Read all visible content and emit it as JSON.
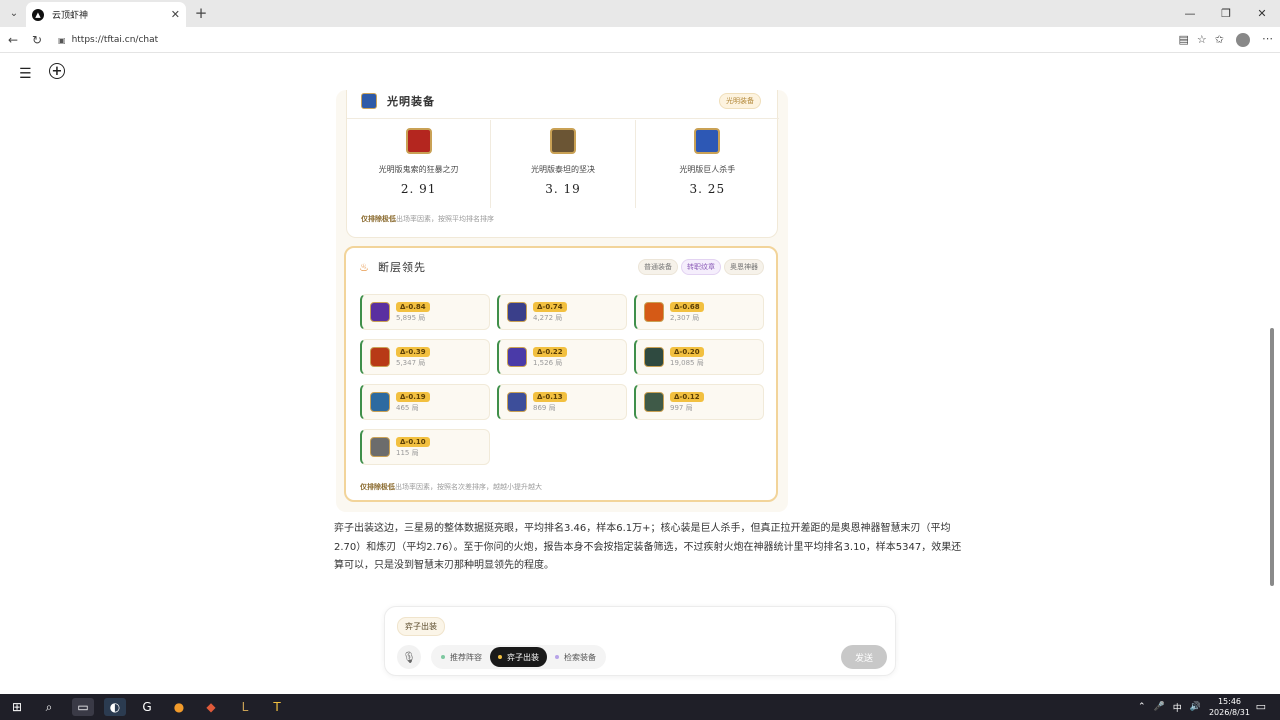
{
  "browser": {
    "tab_title": "云顶虾神",
    "url": "https://tftai.cn/chat",
    "window_controls": [
      "—",
      "❐",
      "✕"
    ]
  },
  "equipment_section": {
    "title": "光明装备",
    "badge": "光明装备",
    "items": [
      {
        "name": "光明版鬼索的狂暴之刃",
        "value": "2. 91",
        "color": "#b4261f"
      },
      {
        "name": "光明版泰坦的坚决",
        "value": "3. 19",
        "color": "#6b5534"
      },
      {
        "name": "光明版巨人杀手",
        "value": "3. 25",
        "color": "#2d58b5"
      }
    ],
    "note_strong": "仅排除极低",
    "note_rest": "出场率因素，按照平均排名排序"
  },
  "breakpoint_section": {
    "title": "断层领先",
    "pills": [
      "普通装备",
      "转职纹章",
      "奥恩神器"
    ],
    "active_pill": 1,
    "items": [
      {
        "delta": "Δ-0.84",
        "games": "5,895 局",
        "color": "#5a2fa0"
      },
      {
        "delta": "Δ-0.74",
        "games": "4,272 局",
        "color": "#3a3f8a"
      },
      {
        "delta": "Δ-0.68",
        "games": "2,307 局",
        "color": "#d55a16"
      },
      {
        "delta": "Δ-0.39",
        "games": "5,347 局",
        "color": "#b83a16"
      },
      {
        "delta": "Δ-0.22",
        "games": "1,526 局",
        "color": "#4a3aa8"
      },
      {
        "delta": "Δ-0.20",
        "games": "19,085 局",
        "color": "#2f4a40"
      },
      {
        "delta": "Δ-0.19",
        "games": "465 局",
        "color": "#2d6aa0"
      },
      {
        "delta": "Δ-0.13",
        "games": "869 局",
        "color": "#3d4e9a"
      },
      {
        "delta": "Δ-0.12",
        "games": "997 局",
        "color": "#3f5a48"
      },
      {
        "delta": "Δ-0.10",
        "games": "115 局",
        "color": "#6c6c6c"
      }
    ],
    "note_strong": "仅排除极低",
    "note_rest": "出场率因素，按照名次差排序，越越小提升越大"
  },
  "answer": "弈子出装这边，三星易的整体数据挺亮眼，平均排名3.46，样本6.1万+；核心装是巨人杀手，但真正拉开差距的是奥恩神器智慧末刃（平均2.70）和炼刃（平均2.76）。至于你问的火炮，报告本身不会按指定装备筛选，不过疾射火炮在神器统计里平均排名3.10，样本5347，效果还算可以，只是没到智慧末刃那种明显领先的程度。",
  "composer": {
    "chip": "弈子出装",
    "modes": [
      {
        "label": "推荐阵容",
        "dot": "#7ec8a0"
      },
      {
        "label": "弈子出装",
        "dot": "#f2c040"
      },
      {
        "label": "检索装备",
        "dot": "#b7a3e8"
      }
    ],
    "active_mode": 1,
    "send_label": "发送"
  },
  "taskbar": {
    "time": "15:46",
    "date": "2026/8/31",
    "ime": "中"
  }
}
